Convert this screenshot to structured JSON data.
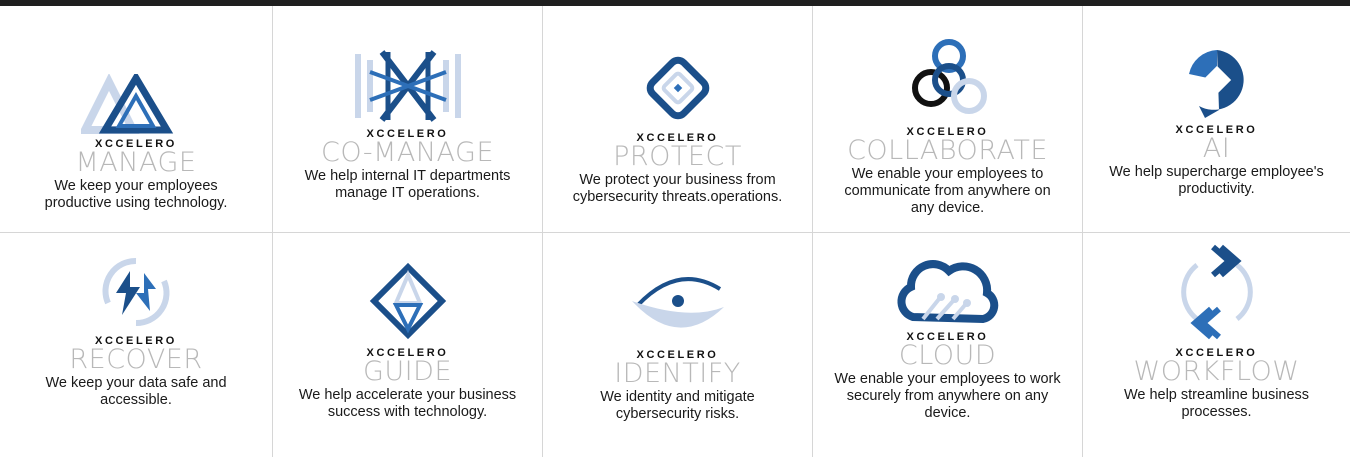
{
  "brand": "XCCELERO",
  "colors": {
    "dark_blue": "#1b4f8a",
    "mid_blue": "#2d6fb8",
    "light_blue": "#c9d6ea",
    "black": "#111111",
    "label_gray": "#b8b8b8"
  },
  "services": [
    {
      "name": "MANAGE",
      "icon": "triangle-manage-icon",
      "description": "We keep your employees productive using technology."
    },
    {
      "name": "CO-MANAGE",
      "icon": "crossed-bowtie-icon",
      "description": "We help internal IT departments manage IT operations."
    },
    {
      "name": "PROTECT",
      "icon": "shield-diamond-icon",
      "description": "We protect your business from cybersecurity threats.operations."
    },
    {
      "name": "COLLABORATE",
      "icon": "linked-rings-icon",
      "description": "We enable your employees to communicate from anywhere on any device."
    },
    {
      "name": "AI",
      "icon": "ai-chat-diamond-icon",
      "description": "We help supercharge employee's productivity."
    },
    {
      "name": "RECOVER",
      "icon": "circular-arrows-icon",
      "description": "We keep your data safe and accessible."
    },
    {
      "name": "GUIDE",
      "icon": "compass-diamond-icon",
      "description": "We help accelerate your business success with technology."
    },
    {
      "name": "IDENTIFY",
      "icon": "eye-icon",
      "description": "We identity and mitigate cybersecurity risks."
    },
    {
      "name": "CLOUD",
      "icon": "circuit-cloud-icon",
      "description": "We enable your employees to work securely from anywhere on any device."
    },
    {
      "name": "WORKFLOW",
      "icon": "chevron-cycle-icon",
      "description": "We help streamline business processes."
    }
  ]
}
